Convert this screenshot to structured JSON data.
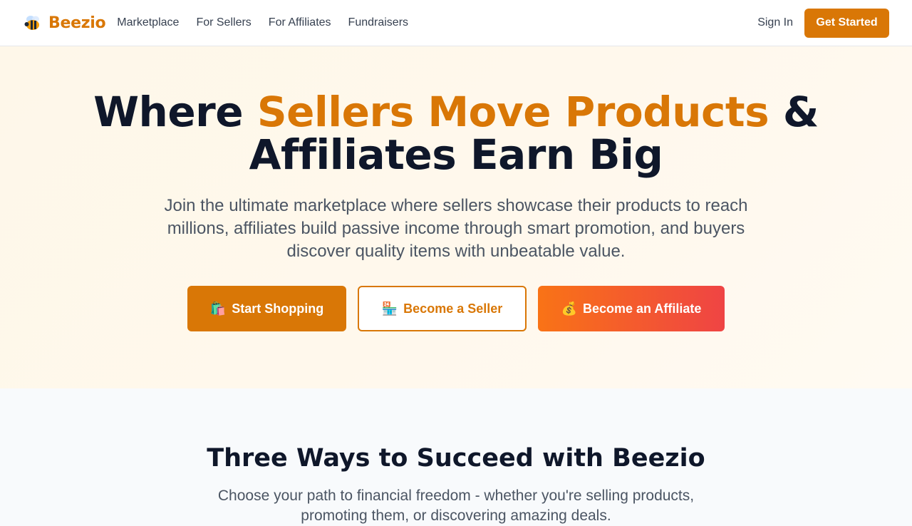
{
  "nav": {
    "brand": "Beezio",
    "brand_icon": "bee-icon",
    "links": [
      "Marketplace",
      "For Sellers",
      "For Affiliates",
      "Fundraisers"
    ],
    "sign_in": "Sign In",
    "cta": "Get Started"
  },
  "hero": {
    "title_part1": "Where ",
    "title_accent": "Sellers Move Products",
    "title_part2": " & Affiliates Earn Big",
    "subtitle": "Join the ultimate marketplace where sellers showcase their products to reach millions, affiliates build passive income through smart promotion, and buyers discover quality items with unbeatable value.",
    "buttons": {
      "shop": {
        "label": "Start Shopping",
        "icon": "🛍️"
      },
      "seller": {
        "label": "Become a Seller",
        "icon": "🏪"
      },
      "affiliate": {
        "label": "Become an Affiliate",
        "icon": "💰"
      }
    }
  },
  "section": {
    "title": "Three Ways to Succeed with Beezio",
    "subtitle": "Choose your path to financial freedom - whether you're selling products, promoting them, or discovering amazing deals."
  },
  "colors": {
    "accent": "#d97706",
    "text_dark": "#0f172a",
    "gradient_start": "#f97316",
    "gradient_end": "#ef4444"
  }
}
